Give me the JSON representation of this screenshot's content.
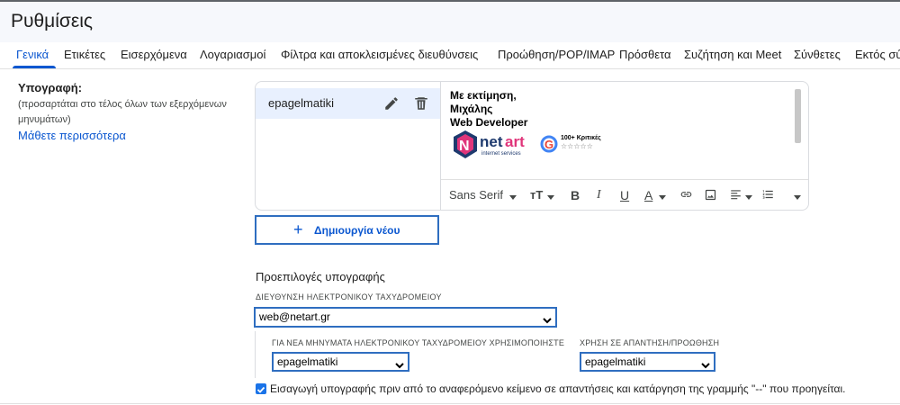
{
  "page": {
    "title": "Ρυθμίσεις"
  },
  "tabs": [
    {
      "label": "Γενικά",
      "active": true
    },
    {
      "label": "Ετικέτες"
    },
    {
      "label": "Εισερχόμενα"
    },
    {
      "label": "Λογαριασμοί"
    },
    {
      "label": "Φίλτρα και αποκλεισμένες διευθύνσεις"
    },
    {
      "label": "Προώθηση/POP/IMAP"
    },
    {
      "label": "Πρόσθετα"
    },
    {
      "label": "Συζήτηση και Meet"
    },
    {
      "label": "Σύνθετες"
    },
    {
      "label": "Εκτός σύ"
    }
  ],
  "signature": {
    "label": "Υπογραφή:",
    "sublabel": "(προσαρτάται στο τέλος όλων των εξερχόμενων μηνυμάτων)",
    "learn_more": "Μάθετε περισσότερα",
    "list": [
      {
        "name": "epagelmatiki",
        "selected": true
      }
    ],
    "editor": {
      "lines": [
        "Με εκτίμηση,",
        "Μιχάλης",
        "Web Developer"
      ],
      "logo": {
        "brand_1": "net",
        "brand_2": "art",
        "brand_sub": "internet services",
        "reviews": "100+ Κριτικές",
        "stars": "☆☆☆☆☆",
        "google_letter": "G"
      }
    },
    "toolbar": {
      "font": "Sans Serif",
      "size_icon": "тT",
      "bold": "B",
      "italic": "I",
      "underline": "U",
      "text_color": "A"
    },
    "create_new": "Δημιουργία νέου"
  },
  "defaults": {
    "title": "Προεπιλογές υπογραφής",
    "email_label": "ΔΙΕΥΘΥΝΣΗ ΗΛΕΚΤΡΟΝΙΚΟΥ ΤΑΧΥΔΡΟΜΕΙΟΥ",
    "email_value": "web@netart.gr",
    "new_label": "ΓΙΑ ΝΕΑ ΜΗΝΥΜΑΤΑ ΗΛΕΚΤΡΟΝΙΚΟΥ ΤΑΧΥΔΡΟΜΕΙΟΥ ΧΡΗΣΙΜΟΠΟΙΗΣΤΕ",
    "new_value": "epagelmatiki",
    "reply_label": "ΧΡΗΣΗ ΣΕ ΑΠΑΝΤΗΣΗ/ΠΡΟΩΘΗΣΗ",
    "reply_value": "epagelmatiki",
    "insert_before_quote": {
      "checked": true,
      "label": "Εισαγωγή υπογραφής πριν από το αναφερόμενο κείμενο σε απαντήσεις και κατάργηση της γραμμής \"--\" που προηγείται."
    }
  },
  "colors": {
    "accent": "#0b57d0",
    "selected_bg": "#e8f0fe",
    "focus_border": "#2f6ec0"
  }
}
